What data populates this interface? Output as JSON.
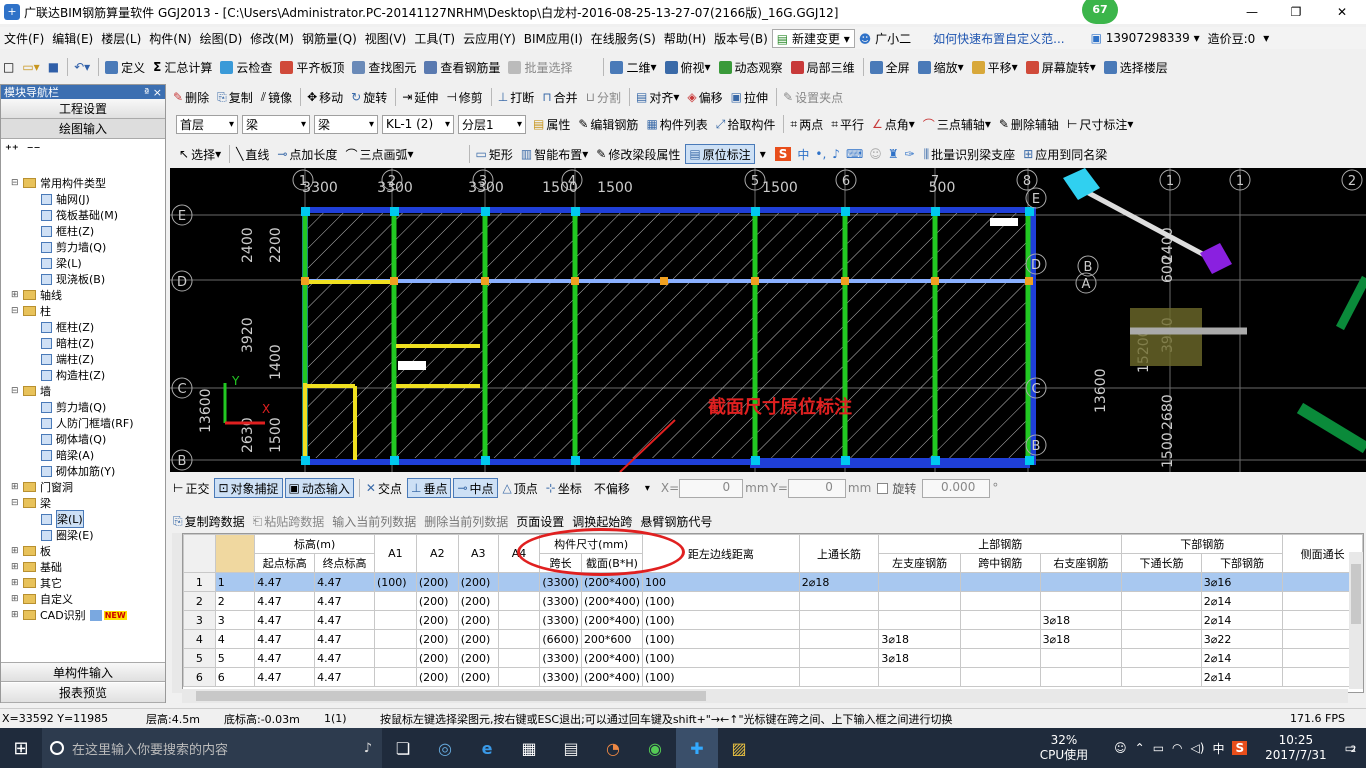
{
  "window": {
    "title": "广联达BIM钢筋算量软件 GGJ2013 - [C:\\Users\\Administrator.PC-20141127NRHM\\Desktop\\白龙村-2016-08-25-13-27-07(2166版)_16G.GGJ12]",
    "badge": "67",
    "controls": [
      "—",
      "❐",
      "✕"
    ]
  },
  "menu": {
    "items": [
      "文件(F)",
      "编辑(E)",
      "楼层(L)",
      "构件(N)",
      "绘图(D)",
      "修改(M)",
      "钢筋量(Q)",
      "视图(V)",
      "工具(T)",
      "云应用(Y)",
      "BIM应用(I)",
      "在线服务(S)",
      "帮助(H)",
      "版本号(B)"
    ],
    "new_change": "新建变更",
    "assistant": "广小二",
    "help_link": "如何快速布置自定义范...",
    "phone": "13907298339",
    "coins": "造价豆:0"
  },
  "toolbar1": [
    "定义",
    "汇总计算",
    "云检查",
    "平齐板顶",
    "查找图元",
    "查看钢筋量",
    "批量选择",
    "二维",
    "俯视",
    "动态观察",
    "局部三维",
    "全屏",
    "缩放",
    "平移",
    "屏幕旋转",
    "选择楼层"
  ],
  "nav": {
    "header": "模块导航栏",
    "pin": "ª ×",
    "project_settings": "工程设置",
    "drawing_input": "绘图输入",
    "single_input": "单构件输入",
    "report": "报表预览",
    "tree": [
      {
        "label": "常用构件类型",
        "level": 0,
        "type": "folder",
        "exp": "⊟"
      },
      {
        "label": "轴网(J)",
        "level": 1,
        "type": "leaf"
      },
      {
        "label": "筏板基础(M)",
        "level": 1,
        "type": "leaf"
      },
      {
        "label": "框柱(Z)",
        "level": 1,
        "type": "leaf"
      },
      {
        "label": "剪力墙(Q)",
        "level": 1,
        "type": "leaf"
      },
      {
        "label": "梁(L)",
        "level": 1,
        "type": "leaf"
      },
      {
        "label": "现浇板(B)",
        "level": 1,
        "type": "leaf"
      },
      {
        "label": "轴线",
        "level": 0,
        "type": "folder",
        "exp": "⊞"
      },
      {
        "label": "柱",
        "level": 0,
        "type": "folder",
        "exp": "⊟"
      },
      {
        "label": "框柱(Z)",
        "level": 1,
        "type": "leaf"
      },
      {
        "label": "暗柱(Z)",
        "level": 1,
        "type": "leaf"
      },
      {
        "label": "端柱(Z)",
        "level": 1,
        "type": "leaf"
      },
      {
        "label": "构造柱(Z)",
        "level": 1,
        "type": "leaf"
      },
      {
        "label": "墙",
        "level": 0,
        "type": "folder",
        "exp": "⊟"
      },
      {
        "label": "剪力墙(Q)",
        "level": 1,
        "type": "leaf"
      },
      {
        "label": "人防门框墙(RF)",
        "level": 1,
        "type": "leaf"
      },
      {
        "label": "砌体墙(Q)",
        "level": 1,
        "type": "leaf"
      },
      {
        "label": "暗梁(A)",
        "level": 1,
        "type": "leaf"
      },
      {
        "label": "砌体加筋(Y)",
        "level": 1,
        "type": "leaf"
      },
      {
        "label": "门窗洞",
        "level": 0,
        "type": "folder",
        "exp": "⊞"
      },
      {
        "label": "梁",
        "level": 0,
        "type": "folder",
        "exp": "⊟"
      },
      {
        "label": "梁(L)",
        "level": 1,
        "type": "leaf",
        "selected": true
      },
      {
        "label": "圈梁(E)",
        "level": 1,
        "type": "leaf"
      },
      {
        "label": "板",
        "level": 0,
        "type": "folder",
        "exp": "⊞"
      },
      {
        "label": "基础",
        "level": 0,
        "type": "folder",
        "exp": "⊞"
      },
      {
        "label": "其它",
        "level": 0,
        "type": "folder",
        "exp": "⊞"
      },
      {
        "label": "自定义",
        "level": 0,
        "type": "folder",
        "exp": "⊞"
      },
      {
        "label": "CAD识别",
        "level": 0,
        "type": "folder",
        "exp": "⊞",
        "new": "NEW"
      }
    ]
  },
  "toolbar2": [
    "删除",
    "复制",
    "镜像",
    "移动",
    "旋转",
    "延伸",
    "修剪",
    "打断",
    "合并",
    "分割",
    "对齐",
    "偏移",
    "拉伸",
    "设置夹点"
  ],
  "toolbar3": {
    "floor": "首层",
    "cat": "梁",
    "type": "梁",
    "member": "KL-1 (2)",
    "layer": "分层1",
    "items": [
      "属性",
      "编辑钢筋",
      "构件列表",
      "拾取构件",
      "两点",
      "平行",
      "点角",
      "三点辅轴",
      "删除辅轴",
      "尺寸标注"
    ]
  },
  "toolbar4": [
    "选择",
    "直线",
    "点加长度",
    "三点画弧",
    "矩形",
    "智能布置",
    "修改梁段属性",
    "原位标注",
    "批量识别梁支座",
    "应用到同名梁"
  ],
  "canvas": {
    "top_dims": [
      "3300",
      "3300",
      "3300",
      "1500",
      "1500",
      "1500",
      "500",
      "1500",
      "500"
    ],
    "axis_top": [
      "1",
      "2",
      "3",
      "4",
      "5",
      "6",
      "7",
      "8",
      "1",
      "1",
      "2"
    ],
    "axis_left": [
      "E",
      "D",
      "C",
      "B"
    ],
    "axis_right": [
      "E",
      "D",
      "C",
      "B"
    ],
    "axis_far": [
      "B",
      "A"
    ],
    "left_dims": [
      "2400",
      "2200",
      "3920",
      "1400",
      "13600",
      "2630",
      "1500"
    ],
    "right_dims": [
      "2400",
      "600",
      "3920",
      "15200",
      "13600",
      "2680",
      "1500"
    ],
    "annotation": "截面尺寸原位标注",
    "ucs_y": "Y",
    "ucs_x": "X"
  },
  "snapbar": {
    "items": [
      "正交",
      "对象捕捉",
      "动态输入",
      "交点",
      "垂点",
      "中点",
      "顶点",
      "坐标"
    ],
    "offset": "不偏移",
    "x_label": "X=",
    "x_val": "0",
    "unit1": "mm",
    "y_label": "Y=",
    "y_val": "0",
    "unit2": "mm",
    "rotate": "旋转",
    "rot_val": "0.000",
    "deg": "°"
  },
  "gridtb": [
    "复制跨数据",
    "粘贴跨数据",
    "输入当前列数据",
    "删除当前列数据",
    "页面设置",
    "调换起始跨",
    "悬臂钢筋代号"
  ],
  "grid": {
    "group_headers": {
      "elev": "标高(m)",
      "size": "构件尺寸(mm)",
      "top": "上通长筋",
      "upper": "上部钢筋",
      "lower": "下部钢筋",
      "side": "侧面通长"
    },
    "headers": [
      "起点标高",
      "终点标高",
      "A1",
      "A2",
      "A3",
      "A4",
      "跨长",
      "截面(B*H)",
      "距左边线距离",
      "左支座钢筋",
      "跨中钢筋",
      "右支座钢筋",
      "下通长筋",
      "下部钢筋",
      "侧面通长"
    ],
    "rows": [
      [
        "1",
        "1",
        "4.47",
        "4.47",
        "(100)",
        "(200)",
        "(200)",
        "",
        "(3300)",
        "(200*400)",
        "100",
        "2⌀18",
        "",
        "",
        "",
        "",
        "3⌀16",
        ""
      ],
      [
        "2",
        "2",
        "4.47",
        "4.47",
        "",
        "(200)",
        "(200)",
        "",
        "(3300)",
        "(200*400)",
        "(100)",
        "",
        "",
        "",
        "",
        "",
        "2⌀14",
        ""
      ],
      [
        "3",
        "3",
        "4.47",
        "4.47",
        "",
        "(200)",
        "(200)",
        "",
        "(3300)",
        "(200*400)",
        "(100)",
        "",
        "",
        "",
        "3⌀18",
        "",
        "2⌀14",
        ""
      ],
      [
        "4",
        "4",
        "4.47",
        "4.47",
        "",
        "(200)",
        "(200)",
        "",
        "(6600)",
        "200*600",
        "(100)",
        "",
        "3⌀18",
        "",
        "3⌀18",
        "",
        "3⌀22",
        ""
      ],
      [
        "5",
        "5",
        "4.47",
        "4.47",
        "",
        "(200)",
        "(200)",
        "",
        "(3300)",
        "(200*400)",
        "(100)",
        "",
        "3⌀18",
        "",
        "",
        "",
        "2⌀14",
        ""
      ],
      [
        "6",
        "6",
        "4.47",
        "4.47",
        "",
        "(200)",
        "(200)",
        "",
        "(3300)",
        "(200*400)",
        "(100)",
        "",
        "",
        "",
        "",
        "",
        "2⌀14",
        ""
      ]
    ]
  },
  "status": {
    "coords": "X=33592 Y=11985",
    "floor_h": "层高:4.5m",
    "base": "底标高:-0.03m",
    "count": "1(1)",
    "hint": "按鼠标左键选择梁图元,按右键或ESC退出;可以通过回车键及shift+\"→←↑\"光标键在跨之间、上下输入框之间进行切换",
    "fps": "171.6 FPS"
  },
  "taskbar": {
    "search": "在这里输入你要搜索的内容",
    "cpu_pct": "32%",
    "cpu_label": "CPU使用",
    "ime": "中",
    "time": "10:25",
    "date": "2017/7/31",
    "notif": "2"
  },
  "colors": {
    "accent": "#3c6fb1",
    "annotation": "#e02020",
    "beam_green": "#22c822",
    "beam_yellow": "#f0e020",
    "wall_blue": "#1f3fd8"
  }
}
